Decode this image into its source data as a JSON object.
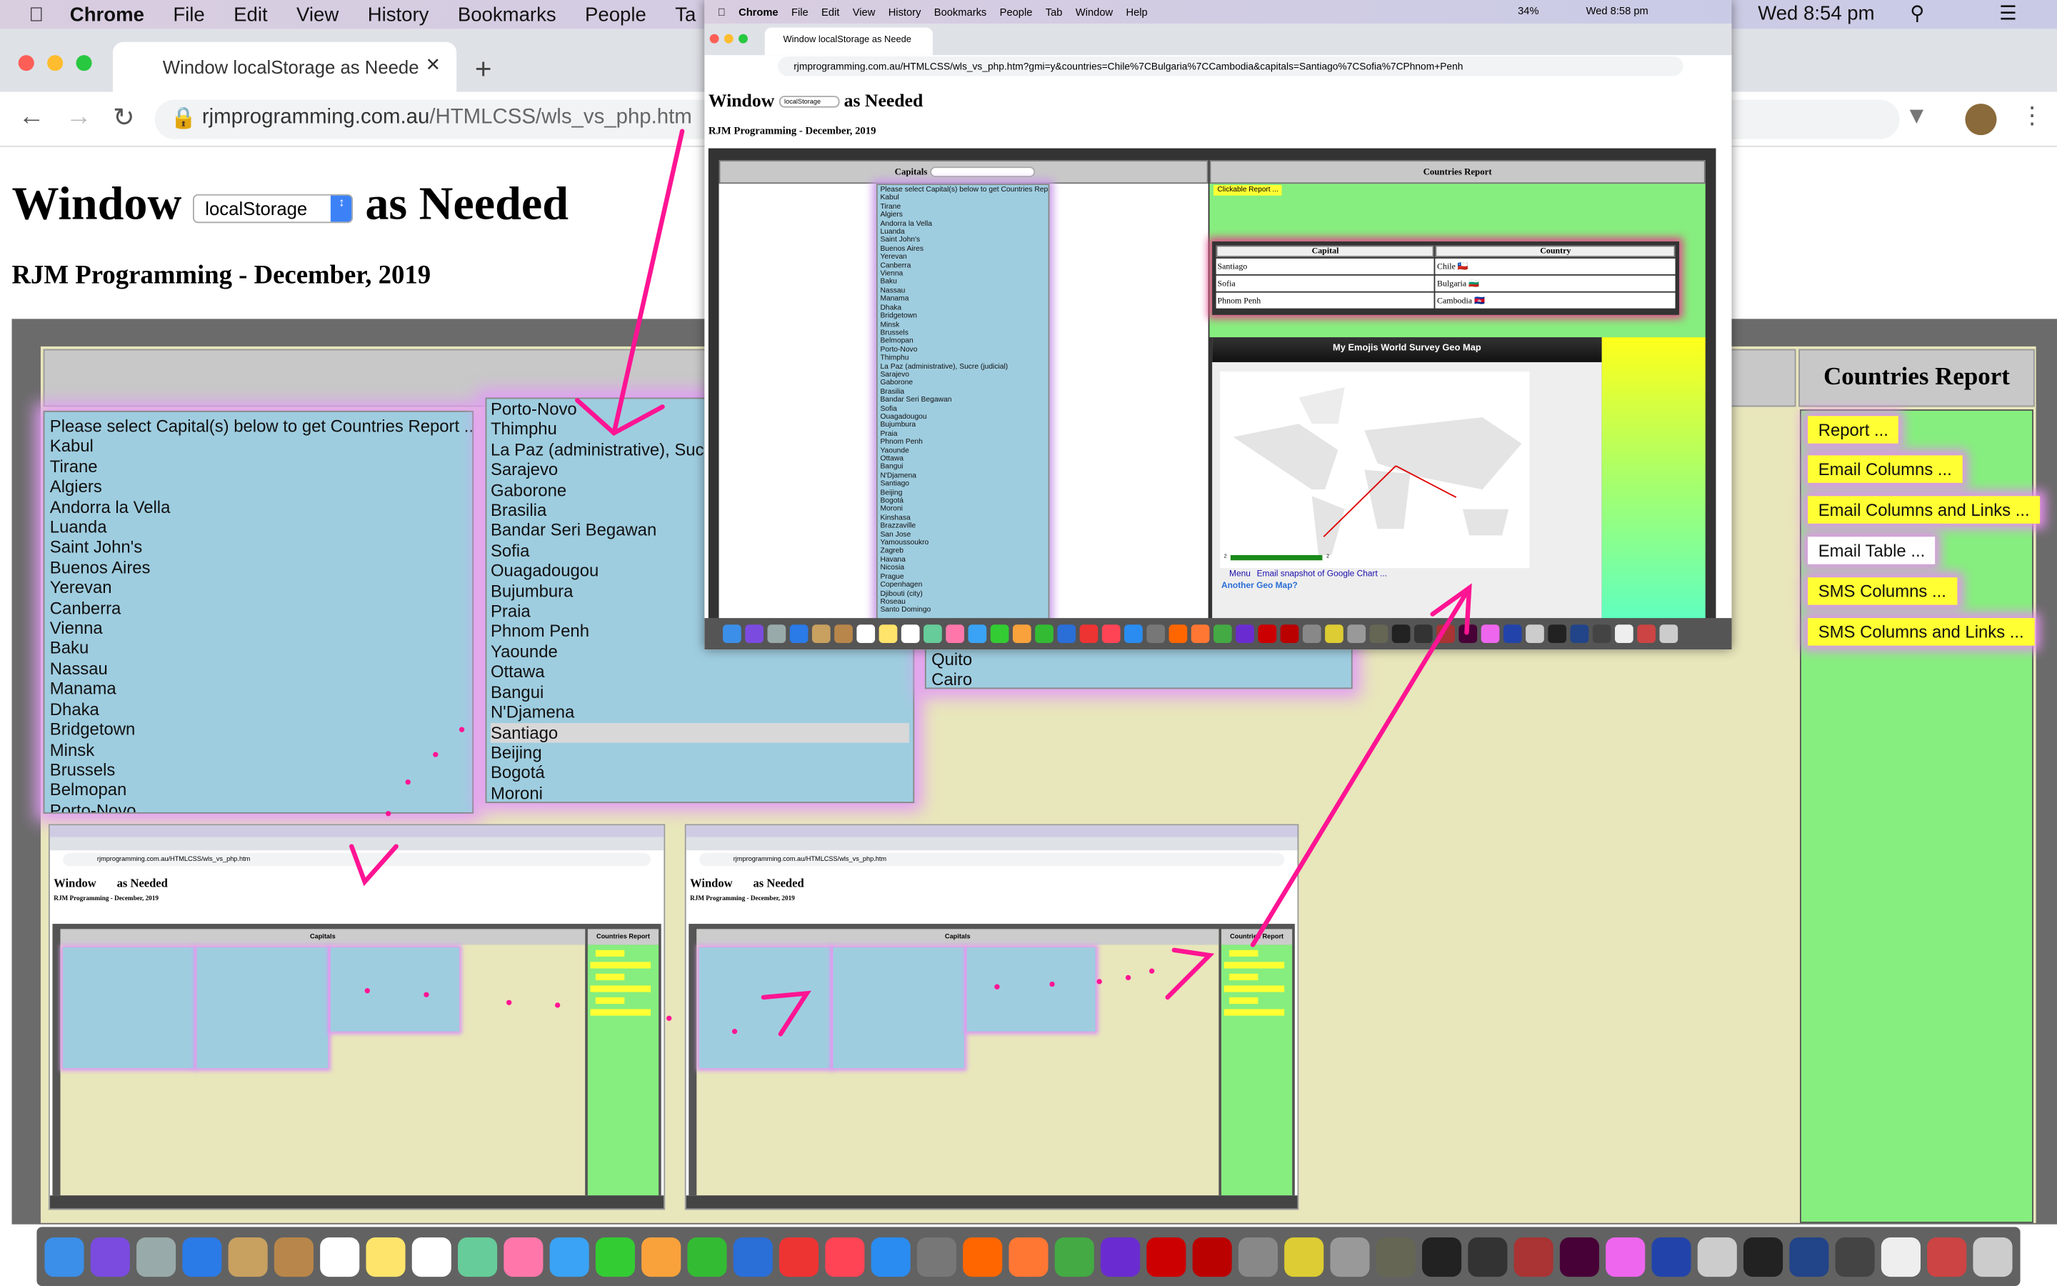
{
  "menubar": {
    "app": "Chrome",
    "items": [
      "File",
      "Edit",
      "View",
      "History",
      "Bookmarks",
      "People",
      "Ta"
    ],
    "clock": "Wed 8:54 pm"
  },
  "browser": {
    "tab_title": "Window localStorage as Neede",
    "url_host": "rjmprogramming.com.au",
    "url_path": "/HTMLCSS/wls_vs_php.htm"
  },
  "page": {
    "title_before": "Window",
    "storage_select": "localStorage",
    "title_after": "as Needed",
    "subtitle": "RJM Programming - December, 2019",
    "capitals_header": "Capitals",
    "report_header": "Countries Report"
  },
  "capitals": [
    "Please select Capital(s) below to get Countries Report ...",
    "Kabul",
    "Tirane",
    "Algiers",
    "Andorra la Vella",
    "Luanda",
    "Saint John's",
    "Buenos Aires",
    "Yerevan",
    "Canberra",
    "Vienna",
    "Baku",
    "Nassau",
    "Manama",
    "Dhaka",
    "Bridgetown",
    "Minsk",
    "Brussels",
    "Belmopan",
    "Porto-Novo"
  ],
  "capitals2": [
    "Porto-Novo",
    "Thimphu",
    "La Paz (administrative), Sucre (judicial)",
    "Sarajevo",
    "Gaborone",
    "Brasilia",
    "Bandar Seri Begawan",
    "Sofia",
    "Ouagadougou",
    "Bujumbura",
    "Praia",
    "Phnom Penh",
    "Yaounde",
    "Ottawa",
    "Bangui",
    "N'Djamena",
    "Santiago",
    "Beijing",
    "Bogotá",
    "Moroni",
    "Kinshasa"
  ],
  "capitals2_selected": "Santiago",
  "capitals3": [
    "Quito",
    "Cairo"
  ],
  "report_buttons": [
    "Report ...",
    "Email Columns ...",
    "Email Columns and Links ...",
    "Email Table ...",
    "SMS Columns ...",
    "SMS Columns and Links ..."
  ],
  "overlay": {
    "menubar": {
      "app": "Chrome",
      "items": [
        "File",
        "Edit",
        "View",
        "History",
        "Bookmarks",
        "People",
        "Tab",
        "Window",
        "Help"
      ],
      "battery": "34%",
      "clock": "Wed 8:58 pm"
    },
    "tab_title": "Window localStorage as Neede",
    "url": "rjmprogramming.com.au/HTMLCSS/wls_vs_php.htm?gmi=y&countries=Chile%7CBulgaria%7CCambodia&capitals=Santiago%7CSofia%7CPhnom+Penh",
    "capitals_list": [
      "Please select Capital(s) below to get Countries Report",
      "Kabul",
      "Tirane",
      "Algiers",
      "Andorra la Vella",
      "Luanda",
      "Saint John's",
      "Buenos Aires",
      "Yerevan",
      "Canberra",
      "Vienna",
      "Baku",
      "Nassau",
      "Manama",
      "Dhaka",
      "Bridgetown",
      "Minsk",
      "Brussels",
      "Belmopan",
      "Porto-Novo",
      "Thimphu",
      "La Paz (administrative), Sucre (judicial)",
      "Sarajevo",
      "Gaborone",
      "Brasilia",
      "Bandar Seri Begawan",
      "Sofia",
      "Ouagadougou",
      "Bujumbura",
      "Praia",
      "Phnom Penh",
      "Yaounde",
      "Ottawa",
      "Bangui",
      "N'Djamena",
      "Santiago",
      "Beijing",
      "Bogotá",
      "Moroni",
      "Kinshasa",
      "Brazzaville",
      "San Jose",
      "Yamoussoukro",
      "Zagreb",
      "Havana",
      "Nicosia",
      "Prague",
      "Copenhagen",
      "Djibouti (city)",
      "Roseau",
      "Santo Domingo"
    ],
    "clickable_report": "Clickable Report ...",
    "table": {
      "headers": [
        "Capital",
        "Country"
      ],
      "rows": [
        [
          "Santiago",
          "Chile 🇨🇱"
        ],
        [
          "Sofia",
          "Bulgaria 🇧🇬"
        ],
        [
          "Phnom Penh",
          "Cambodia 🇰🇭"
        ]
      ]
    },
    "geo": {
      "title": "My Emojis World Survey Geo Map",
      "legend_min": "2",
      "legend_max": "2",
      "menu_link": "Menu",
      "email_link": "Email snapshot of Google Chart ...",
      "another_link": "Another Geo Map?"
    }
  },
  "thumbs": [
    {
      "url": "rjmprogramming.com.au/HTMLCSS/wls_vs_php.htm",
      "title": "Window",
      "after": "as Needed",
      "sub": "RJM Programming - December, 2019",
      "cap": "Capitals",
      "rep": "Countries Report"
    },
    {
      "url": "rjmprogramming.com.au/HTMLCSS/wls_vs_php.htm",
      "title": "Window",
      "after": "as Needed",
      "sub": "RJM Programming - December, 2019",
      "cap": "Capitals",
      "rep": "Countries Report"
    }
  ],
  "colors": {
    "list_bg": "#9fcde0",
    "report_bg": "#86ee7e",
    "button": "#ffff33",
    "arrow": "#ff1493",
    "page_bg": "#e8e6bb"
  },
  "dock": {
    "icons": [
      "finder",
      "siri",
      "launchpad",
      "safari",
      "preview",
      "notes",
      "calendar",
      "stickies",
      "reminders",
      "maps",
      "photos",
      "messages",
      "facetime",
      "pages",
      "numbers",
      "keynote",
      "news",
      "music",
      "app-store",
      "system-preferences",
      "avast",
      "firefox",
      "chrome",
      "phpstorm",
      "opera",
      "filezilla",
      "evernote",
      "cyberduck",
      "automator",
      "gimp",
      "terminal",
      "inkscape",
      "photobooth",
      "xd",
      "pinwheel",
      "libreoffice",
      "preview2",
      "console",
      "quicktime",
      "scanner",
      "textedit",
      "notepad",
      "trash"
    ],
    "colors": [
      "#3b8fe8",
      "#7b4be0",
      "#9aa",
      "#2a7ae8",
      "#c8a060",
      "#b8864a",
      "#fff",
      "#ffe46b",
      "#fff",
      "#6c9",
      "#f7a",
      "#3aa3f5",
      "#3c3",
      "#f9a23c",
      "#3b3",
      "#2a6ed8",
      "#e33",
      "#f45",
      "#2a8cf0",
      "#777",
      "#f60",
      "#f73",
      "#4a4",
      "#6a2cd0",
      "#c00",
      "#b00",
      "#888",
      "#dc3",
      "#999",
      "#665",
      "#222",
      "#333",
      "#a33",
      "#470137",
      "#e6e",
      "#24a",
      "#ccc",
      "#222",
      "#248",
      "#444",
      "#eee",
      "#c44",
      "#ccc"
    ]
  }
}
